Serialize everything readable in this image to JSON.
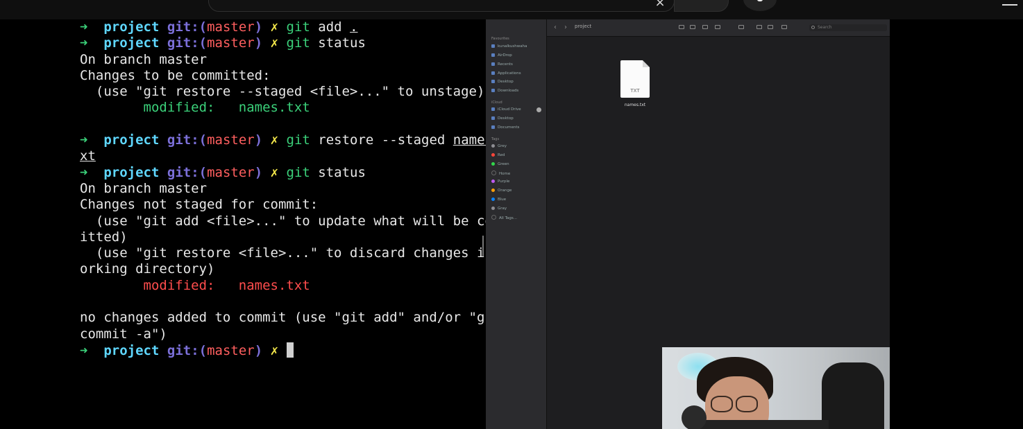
{
  "terminal": {
    "prompt": {
      "arrow": "➜",
      "dir": "project",
      "git": "git:(",
      "branch": "master",
      "close": ")",
      "dirty": "✗"
    },
    "lines": {
      "cmd1_git": "git",
      "cmd1_rest": " add ",
      "cmd1_arg": ".",
      "cmd2_git": "git",
      "cmd2_rest": " status",
      "l3": "On branch master",
      "l4": "Changes to be committed:",
      "l5": "  (use \"git restore --staged <file>...\" to unstage)",
      "l6": "        modified:   names.txt",
      "cmd3_git": "git",
      "cmd3_rest": " restore --staged ",
      "cmd3_arg_a": "names.t",
      "l8": "xt",
      "cmd4_git": "git",
      "cmd4_rest": " status",
      "l10": "On branch master",
      "l11": "Changes not staged for commit:",
      "l12": "  (use \"git add <file>...\" to update what will be comm",
      "l13": "itted)",
      "l14": "  (use \"git restore <file>...\" to discard changes in w",
      "l15": "orking directory)",
      "l16": "        modified:   names.txt",
      "l18": "no changes added to commit (use \"git add\" and/or \"git",
      "l19": "commit -a\")"
    }
  },
  "finder": {
    "title": "project",
    "search_placeholder": "Search",
    "nav_back": "‹",
    "nav_forward": "›",
    "sidebar": {
      "favourites_header": "Favourites",
      "favourites": [
        "kunalkushwaha",
        "AirDrop",
        "Recents",
        "Applications",
        "Desktop",
        "Downloads"
      ],
      "icloud_header": "iCloud",
      "icloud": [
        "iCloud Drive",
        "Desktop",
        "Documents"
      ],
      "tags_header": "Tags",
      "tags": [
        {
          "label": "Grey",
          "color": "#8e8e93"
        },
        {
          "label": "Red",
          "color": "#ff453a"
        },
        {
          "label": "Green",
          "color": "#32d74b"
        },
        {
          "label": "Home",
          "color": "#00000000"
        },
        {
          "label": "Purple",
          "color": "#bf5af2"
        },
        {
          "label": "Orange",
          "color": "#ff9f0a"
        },
        {
          "label": "Blue",
          "color": "#0a84ff"
        },
        {
          "label": "Gray",
          "color": "#8e8e93"
        },
        {
          "label": "All Tags...",
          "color": "#00000000"
        }
      ]
    },
    "file": {
      "name": "names.txt",
      "ext": "TXT"
    }
  },
  "browser": {
    "clear_icon": "×"
  }
}
